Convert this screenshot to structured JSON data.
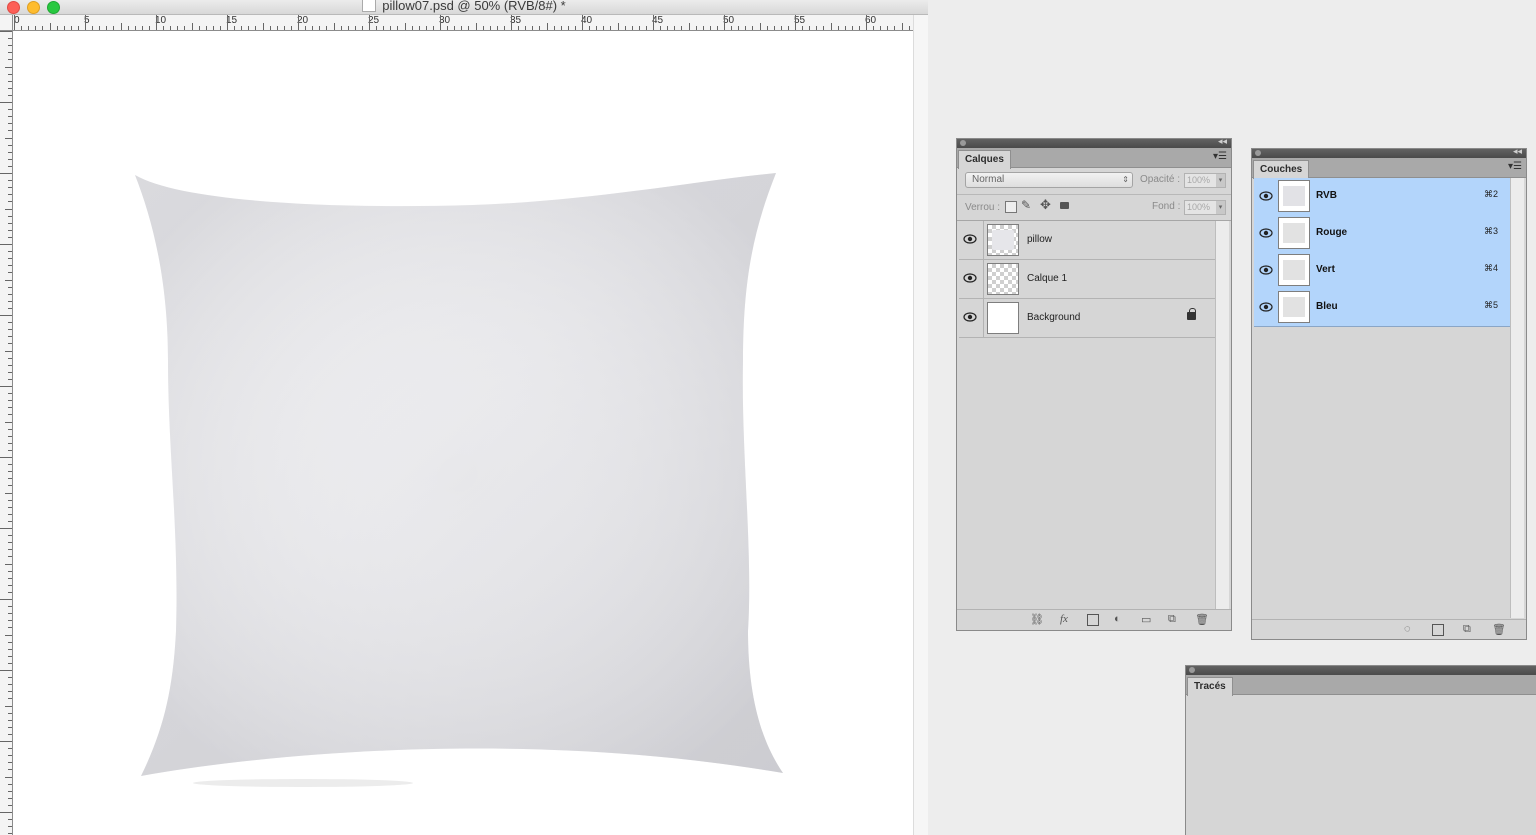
{
  "document": {
    "title": "pillow07.psd @ 50% (RVB/8#) *",
    "ruler_labels": [
      "0",
      "5",
      "10",
      "15",
      "20",
      "25",
      "30",
      "35",
      "40",
      "45",
      "50",
      "55",
      "60"
    ]
  },
  "layers_panel": {
    "tab": "Calques",
    "blend_mode": "Normal",
    "opacity_label": "Opacité :",
    "opacity_value": "100%",
    "lock_label": "Verrou :",
    "fill_label": "Fond :",
    "fill_value": "100%",
    "layers": [
      {
        "name": "pillow",
        "visible": true,
        "locked": false
      },
      {
        "name": "Calque 1",
        "visible": true,
        "locked": false
      },
      {
        "name": "Background",
        "visible": true,
        "locked": true
      }
    ]
  },
  "channels_panel": {
    "tab": "Couches",
    "channels": [
      {
        "name": "RVB",
        "shortcut": "⌘2"
      },
      {
        "name": "Rouge",
        "shortcut": "⌘3"
      },
      {
        "name": "Vert",
        "shortcut": "⌘4"
      },
      {
        "name": "Bleu",
        "shortcut": "⌘5"
      }
    ]
  },
  "paths_panel": {
    "tab": "Tracés"
  },
  "colors": {
    "selected_channel_bg": "#b3d5fb",
    "panel_bg": "#d6d6d6",
    "close": "#fd5f57",
    "minimize": "#febc2e",
    "zoom": "#28c840"
  }
}
